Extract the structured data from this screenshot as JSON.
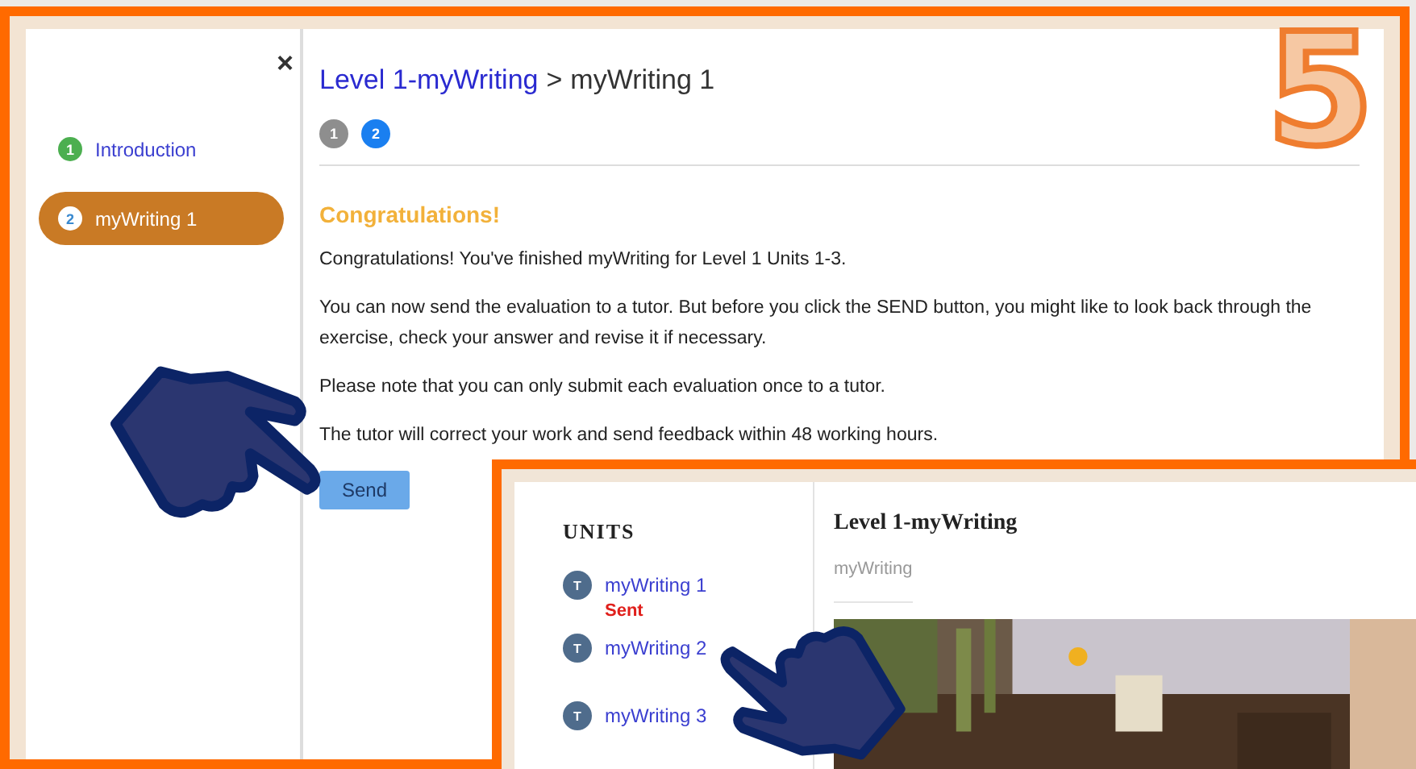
{
  "step_number": "5",
  "lesson": {
    "close": "×",
    "nav": [
      {
        "number": "1",
        "label": "Introduction",
        "selected": false
      },
      {
        "number": "2",
        "label": "myWriting 1",
        "selected": true
      }
    ],
    "breadcrumb": {
      "link": "Level 1-myWriting",
      "separator": ">",
      "current": "myWriting 1"
    },
    "steps": [
      {
        "number": "1",
        "selected": false
      },
      {
        "number": "2",
        "selected": true
      }
    ],
    "heading": "Congratulations!",
    "paragraphs": [
      "Congratulations! You've finished myWriting for Level 1 Units 1-3.",
      "You can now send the evaluation to a tutor. But before you click the SEND button, you might like to look back through the exercise, check your answer and revise it if necessary.",
      "Please note that you can only submit each evaluation once to a tutor.",
      "The tutor will correct your work and send feedback within 48 working hours."
    ],
    "send_button": "Send"
  },
  "units": {
    "title": "UNITS",
    "items": [
      {
        "avatar": "T",
        "label": "myWriting 1",
        "status": "Sent"
      },
      {
        "avatar": "T",
        "label": "myWriting 2"
      },
      {
        "avatar": "T",
        "label": "myWriting 3"
      }
    ],
    "course_title": "Level 1-myWriting",
    "course_subtitle": "myWriting"
  }
}
